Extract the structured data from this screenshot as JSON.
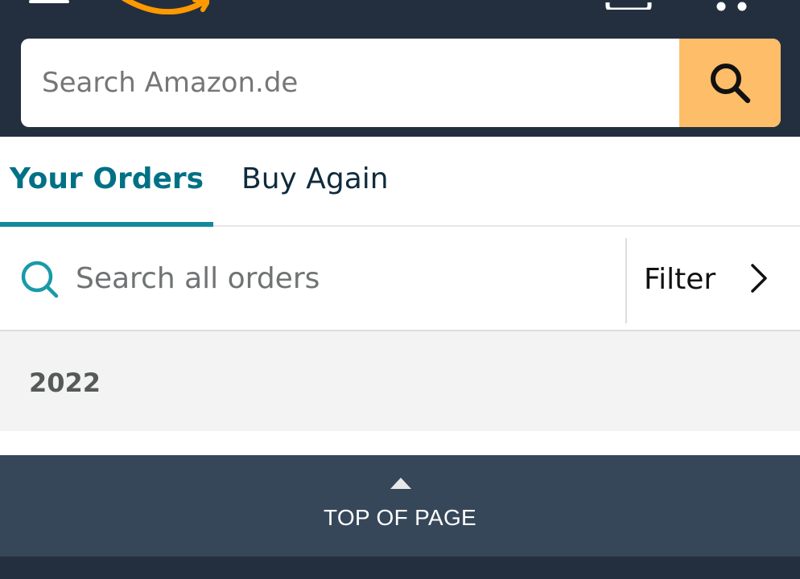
{
  "header": {
    "search": {
      "placeholder": "Search Amazon.de",
      "value": ""
    },
    "icons": [
      "menu-icon",
      "amazon-logo",
      "account-icon",
      "cart-icon",
      "search-icon"
    ],
    "colors": {
      "header_bg": "#232f3e",
      "search_button_bg": "#febd69"
    }
  },
  "tabs": [
    {
      "label": "Your Orders",
      "active": true
    },
    {
      "label": "Buy Again",
      "active": false
    }
  ],
  "orders_search": {
    "placeholder": "Search all orders",
    "value": "",
    "filter_label": "Filter"
  },
  "orders": {
    "year": "2022"
  },
  "footer": {
    "back_to_top_label": "TOP OF PAGE"
  },
  "colors": {
    "active_tab": "#007185",
    "active_tab_underline": "#128a9b",
    "back_to_top_bg": "#37475a"
  }
}
